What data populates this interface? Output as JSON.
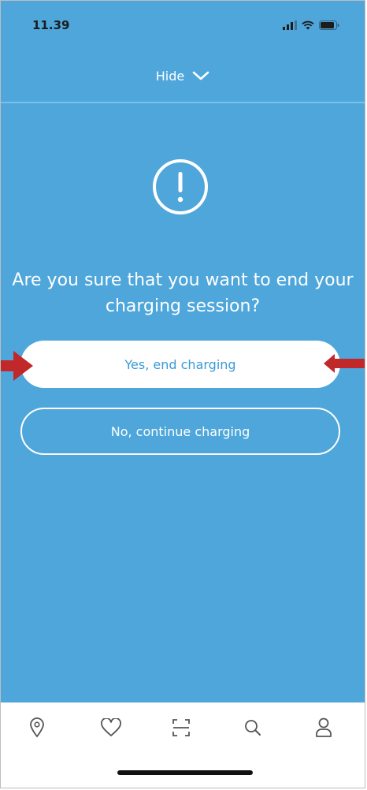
{
  "status_bar": {
    "time": "11.39",
    "icons": [
      "signal-icon",
      "wifi-icon",
      "battery-icon"
    ]
  },
  "header": {
    "hide_label": "Hide",
    "hide_icon": "chevron-down-icon"
  },
  "dialog": {
    "icon": "exclamation-circle-icon",
    "question": "Are you sure that you want to end your charging session?",
    "confirm_label": "Yes, end charging",
    "cancel_label": "No, continue charging"
  },
  "annotations": {
    "arrows": [
      "right-arrow",
      "left-arrow"
    ],
    "arrow_color": "#c0282a"
  },
  "bottom_nav": {
    "items": [
      "map-pin-icon",
      "heart-icon",
      "scan-icon",
      "search-icon",
      "profile-icon"
    ]
  },
  "colors": {
    "background": "#4ea6db",
    "accent_text": "#3a9ad6",
    "white": "#ffffff"
  }
}
